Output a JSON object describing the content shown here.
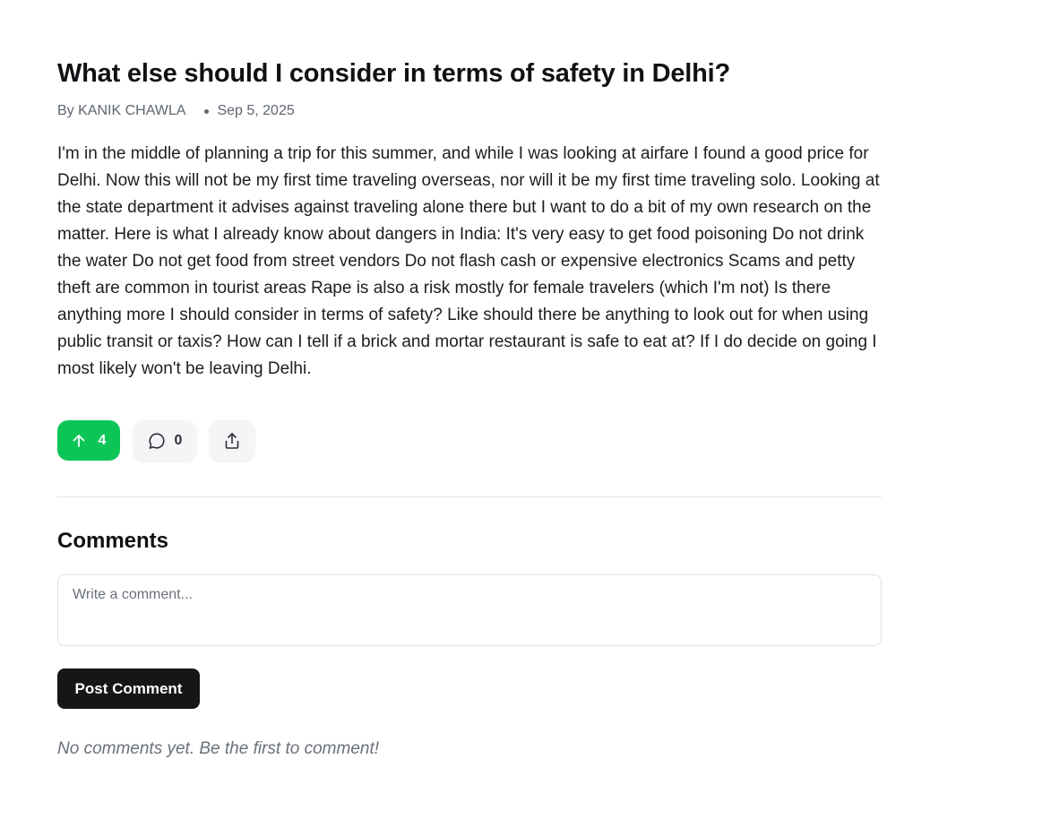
{
  "post": {
    "title": "What else should I consider in terms of safety in Delhi?",
    "author": "By KANIK CHAWLA",
    "date": "Sep 5, 2025",
    "body": "I'm in the middle of planning a trip for this summer, and while I was looking at airfare I found a good price for Delhi. Now this will not be my first time traveling overseas, nor will it be my first time traveling solo. Looking at the state department it advises against traveling alone there but I want to do a bit of my own research on the matter. Here is what I already know about dangers in India: It's very easy to get food poisoning Do not drink the water Do not get food from street vendors Do not flash cash or expensive electronics Scams and petty theft are common in tourist areas Rape is also a risk mostly for female travelers (which I'm not) Is there anything more I should consider in terms of safety? Like should there be anything to look out for when using public transit or taxis? How can I tell if a brick and mortar restaurant is safe to eat at? If I do decide on going I most likely won't be leaving Delhi."
  },
  "actions": {
    "upvote_count": "4",
    "comment_count": "0",
    "upvote_icon": "arrow-up-icon",
    "comment_icon": "chat-bubble-icon",
    "share_icon": "share-icon",
    "accent_color": "#0bc657"
  },
  "comments": {
    "title": "Comments",
    "placeholder": "Write a comment...",
    "value": "",
    "post_button_label": "Post Comment",
    "empty_text": "No comments yet. Be the first to comment!"
  }
}
